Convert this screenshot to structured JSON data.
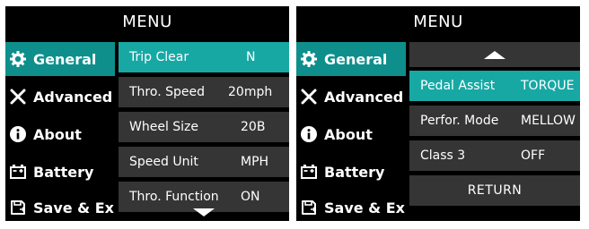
{
  "left_screen": {
    "title": "MENU",
    "sidebar": {
      "items": [
        {
          "label": "General",
          "icon": "gear-icon",
          "active": true
        },
        {
          "label": "Advanced",
          "icon": "tools-icon",
          "active": false
        },
        {
          "label": "About",
          "icon": "info-icon",
          "active": false
        },
        {
          "label": "Battery",
          "icon": "battery-icon",
          "active": false
        },
        {
          "label": "Save & Exit",
          "icon": "save-icon",
          "active": false
        }
      ]
    },
    "settings": {
      "rows": [
        {
          "label": "Trip Clear",
          "value": "N",
          "active": true
        },
        {
          "label": "Thro. Speed",
          "value": "20mph",
          "active": false
        },
        {
          "label": "Wheel Size",
          "value": "20B",
          "active": false
        },
        {
          "label": "Speed Unit",
          "value": "MPH",
          "active": false
        },
        {
          "label": "Thro. Function",
          "value": "ON",
          "active": false
        }
      ],
      "scroll_indicator": "down"
    }
  },
  "right_screen": {
    "title": "MENU",
    "sidebar": {
      "items": [
        {
          "label": "General",
          "icon": "gear-icon",
          "active": true
        },
        {
          "label": "Advanced",
          "icon": "tools-icon",
          "active": false
        },
        {
          "label": "About",
          "icon": "info-icon",
          "active": false
        },
        {
          "label": "Battery",
          "icon": "battery-icon",
          "active": false
        },
        {
          "label": "Save & Exit",
          "icon": "save-icon",
          "active": false
        }
      ]
    },
    "settings": {
      "scroll_indicator": "up",
      "rows": [
        {
          "label": "Pedal Assist",
          "value": "TORQUE",
          "active": true
        },
        {
          "label": "Perfor. Mode",
          "value": "MELLOW",
          "active": false
        },
        {
          "label": "Class 3",
          "value": "OFF",
          "active": false
        }
      ],
      "return_label": "RETURN"
    }
  },
  "colors": {
    "background": "#000000",
    "row_bg": "#353535",
    "active_row": "#17a8a4",
    "active_sidebar": "#0e8f8c",
    "text": "#ffffff"
  }
}
